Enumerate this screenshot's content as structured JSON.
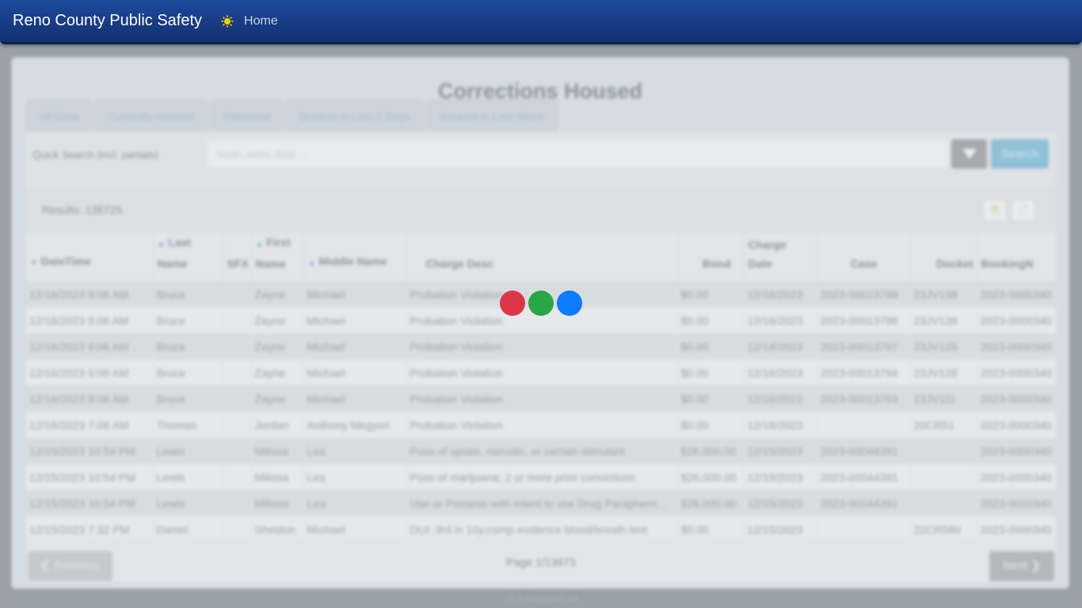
{
  "navbar": {
    "brand": "Reno County Public Safety",
    "home_label": "Home",
    "star_color": "#f1d600"
  },
  "page": {
    "title": "Corrections Housed",
    "footer": "v1.0 ©support.ed"
  },
  "tabs": [
    {
      "label": "All Data"
    },
    {
      "label": "Currently Housed"
    },
    {
      "label": "Released"
    },
    {
      "label": "Booked in Last 2 Days"
    },
    {
      "label": "Booked in Last Week"
    }
  ],
  "search": {
    "label": "Quick Search (incl. partials)",
    "placeholder": "Smith, ssher, 2021 ...",
    "button_label": "Search"
  },
  "results": {
    "text": "Results: 136725"
  },
  "table": {
    "columns": [
      "DateTime",
      "Last Name",
      "SFX",
      "First Name",
      "Middle Name",
      "Charge Desc",
      "Bond",
      "Charge Date",
      "Case",
      "Docket",
      "BookingN"
    ],
    "rows": [
      [
        "12/16/2023 9:06 AM",
        "Bruce",
        "",
        "Zayne",
        "Michael",
        "Probation Violation",
        "$0.00",
        "12/16/2023",
        "2023-00013798",
        "23JV138",
        "2023-0000340"
      ],
      [
        "12/16/2023 9:06 AM",
        "Bruce",
        "",
        "Zayne",
        "Michael",
        "Probation Violation",
        "$0.00",
        "12/16/2023",
        "2023-00013796",
        "23JV136",
        "2023-0000340"
      ],
      [
        "12/16/2023 9:06 AM",
        "Bruce",
        "",
        "Zayne",
        "Michael",
        "Probation Violation",
        "$0.00",
        "12/14/2023",
        "2023-00013797",
        "23JV129",
        "2023-0000340"
      ],
      [
        "12/16/2023 9:06 AM",
        "Bruce",
        "",
        "Zayne",
        "Michael",
        "Probation Violation",
        "$0.00",
        "12/16/2023",
        "2023-00013794",
        "23JV128",
        "2023-0000340"
      ],
      [
        "12/16/2023 9:06 AM",
        "Bruce",
        "",
        "Zayne",
        "Michael",
        "Probation Violation",
        "$0.00",
        "12/16/2023",
        "2023-00013793",
        "23JV111",
        "2023-0000340"
      ],
      [
        "12/16/2023 7:08 AM",
        "Thomas",
        "",
        "Jordan",
        "Anthony Megyeri",
        "Probation Violation",
        "$0.00",
        "12/16/2023",
        "",
        "20CR51",
        "2023-0000340"
      ],
      [
        "12/15/2023 10:54 PM",
        "Lewis",
        "",
        "Milissa",
        "Lea",
        "Poss of opiate, narcotic, or certain stimulant",
        "$26,000.00",
        "12/15/2023",
        "2023-00044391",
        "",
        "2023-0000340"
      ],
      [
        "12/15/2023 10:54 PM",
        "Lewis",
        "",
        "Milissa",
        "Lea",
        "Poss of marijuana; 2 or more prior convictions",
        "$26,000.00",
        "12/15/2023",
        "2023-00044391",
        "",
        "2023-0000340"
      ],
      [
        "12/15/2023 10:54 PM",
        "Lewis",
        "",
        "Milissa",
        "Lea",
        "Use or Possess with Intent to use Drug Paraphernalia",
        "$26,000.00",
        "12/15/2023",
        "2023-00044391",
        "",
        "2023-0000340"
      ],
      [
        "12/15/2023 7:32 PM",
        "Daniel",
        "",
        "Sheldon",
        "Michael",
        "DUI; 3rd in 10y;comp evidence blood/breath test",
        "$0.00",
        "12/15/2023",
        "",
        "22CR580",
        "2023-0000340"
      ]
    ]
  },
  "pager": {
    "prev_label": "Previous",
    "next_label": "Next",
    "page_info": "Page 1/13673"
  },
  "loader": {
    "colors": [
      "#dc3545",
      "#28a745",
      "#0d7bff"
    ]
  }
}
